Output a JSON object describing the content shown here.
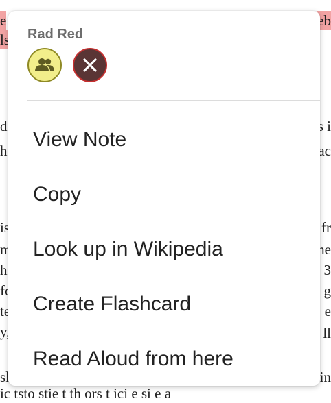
{
  "background": {
    "left_fragments": [
      "e",
      "ls",
      "d",
      "h",
      "is",
      "m",
      "hi",
      "fo",
      "te",
      "y,",
      "sk",
      "ic"
    ],
    "right_fragments": [
      "eb",
      "s i",
      "ac",
      "fr",
      "he",
      "3",
      "g",
      "e",
      "ll",
      "in"
    ],
    "bottom_fragment": "ic     tsto stie t  th ors t ici  e  si e  a"
  },
  "popup": {
    "highlight_color_name": "Rad Red",
    "icons": {
      "share": "people-icon",
      "delete": "close-icon"
    },
    "colors": {
      "share_fill": "#f2ee8b",
      "share_border": "#8f8a25",
      "delete_fill": "#5a3535",
      "delete_border": "#c42f2f",
      "highlight": "#f2a3a3"
    },
    "menu_items": [
      {
        "label": "View Note"
      },
      {
        "label": "Copy"
      },
      {
        "label": "Look up in Wikipedia"
      },
      {
        "label": "Create Flashcard"
      },
      {
        "label": "Read Aloud from here"
      }
    ]
  }
}
